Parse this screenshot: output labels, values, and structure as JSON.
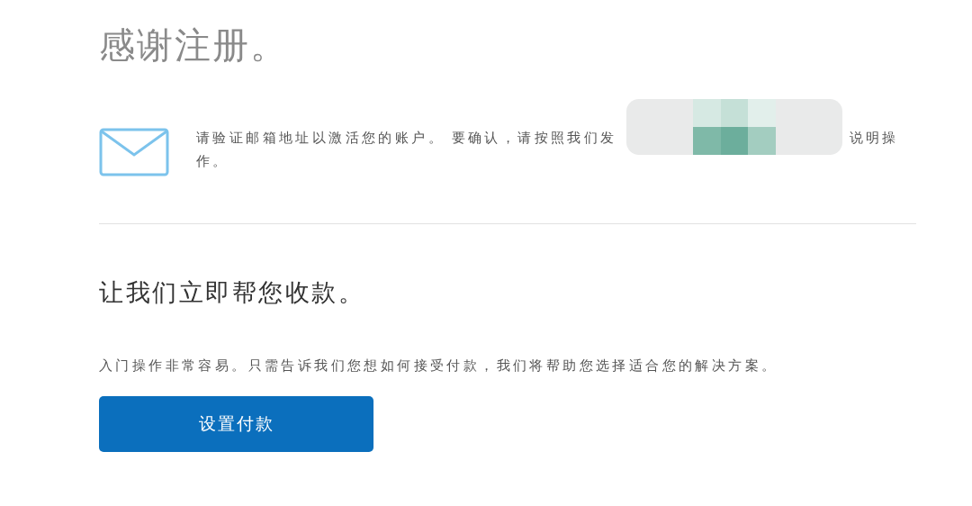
{
  "title": "感谢注册。",
  "notice": {
    "text_before": "请验证邮箱地址以激活您的账户。 要确认，请按照我们发",
    "text_after": "说明操",
    "continuation": "作。"
  },
  "section_heading": "让我们立即帮您收款。",
  "description": "入门操作非常容易。只需告诉我们您想如何接受付款，我们将帮助您选择适合您的解决方案。",
  "button": "设置付款"
}
